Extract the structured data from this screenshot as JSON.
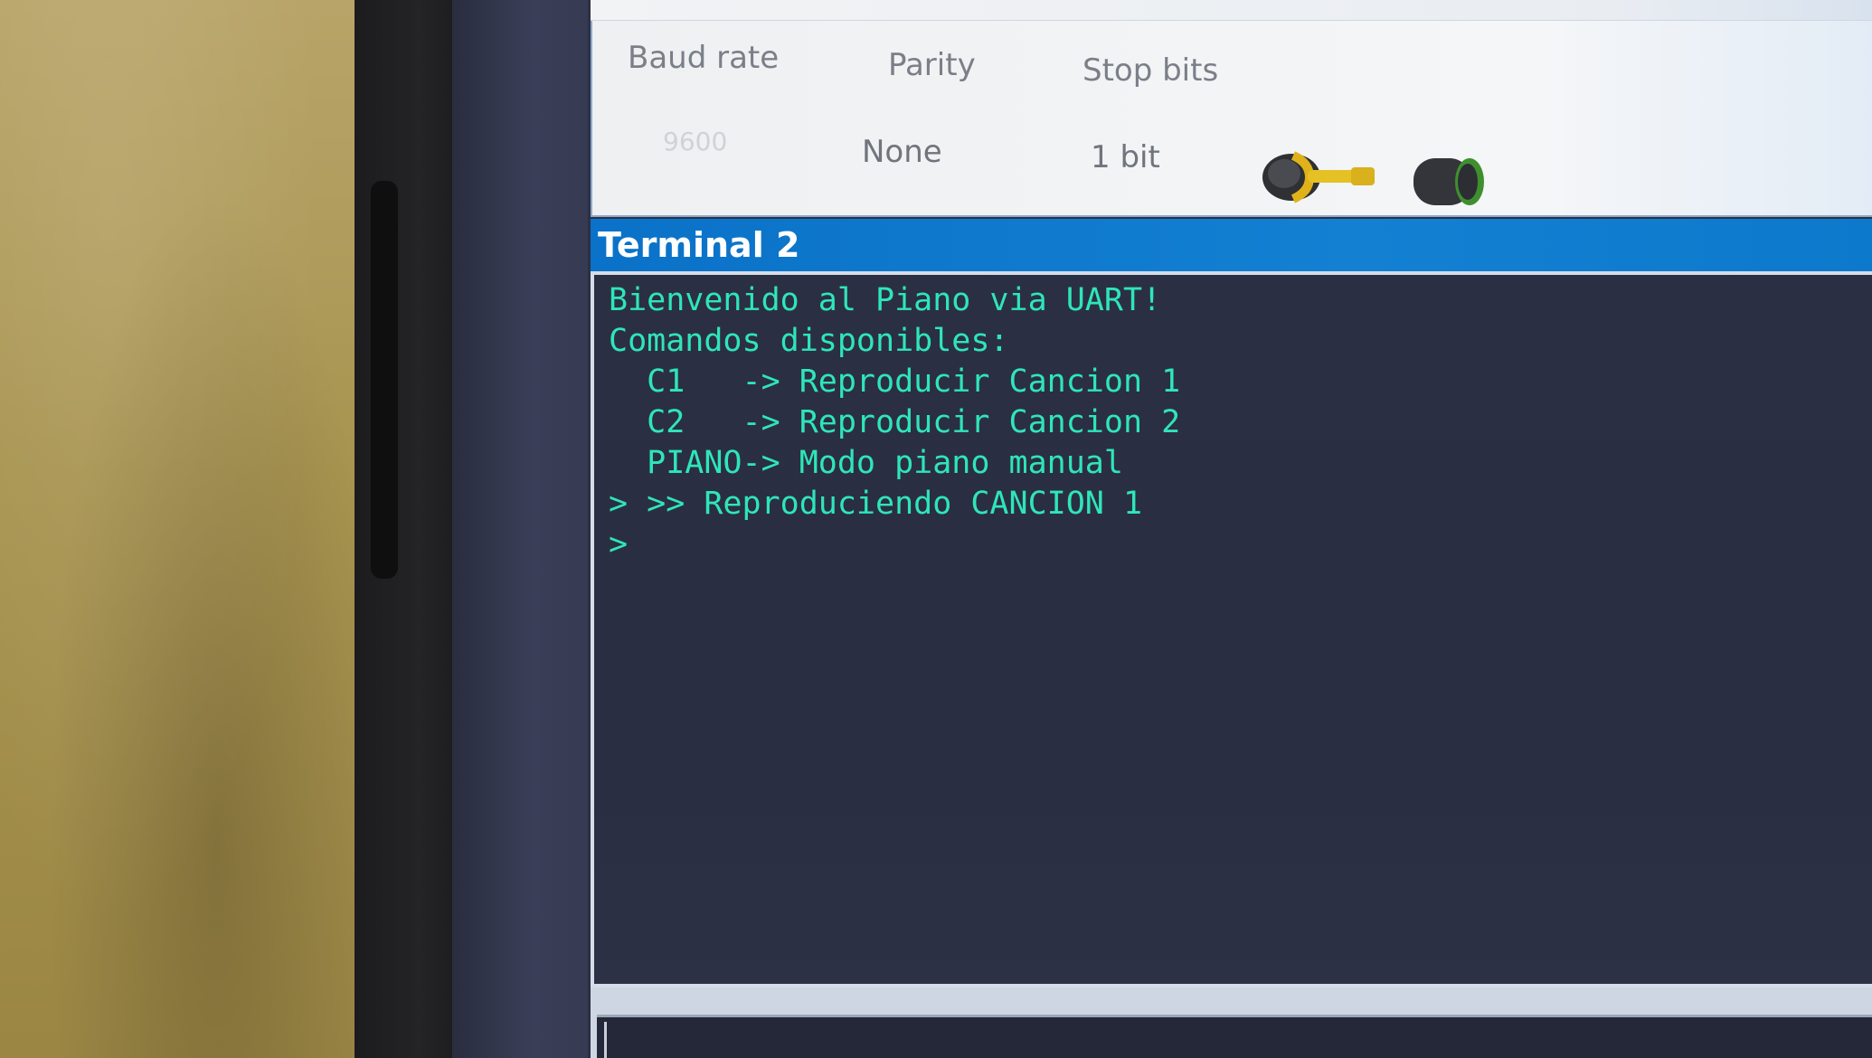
{
  "settings": {
    "baud_rate_label": "Baud rate",
    "parity_label": "Parity",
    "stop_bits_label": "Stop bits",
    "baud_rate_value": "9600",
    "parity_value": "None",
    "stop_bits_value": "1 bit"
  },
  "icons": {
    "connect": "plug-icon",
    "disconnect": "knob-icon"
  },
  "terminal": {
    "title": "Terminal 2",
    "lines": [
      "Bienvenido al Piano via UART!",
      "Comandos disponibles:",
      "  C1   -> Reproducir Cancion 1",
      "  C2   -> Reproducir Cancion 2",
      "  PIANO-> Modo piano manual",
      "> >> Reproduciendo CANCION 1",
      ">"
    ]
  },
  "colors": {
    "terminal_text": "#2ee6b8",
    "title_bar": "#0a72c8",
    "terminal_bg": "#2b2f44"
  }
}
